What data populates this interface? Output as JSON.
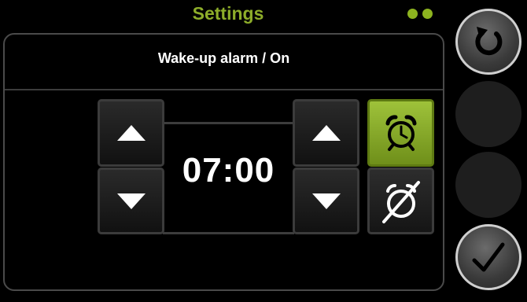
{
  "header": {
    "title": "Settings",
    "page_indicator_count": 2,
    "accent_color": "#8db31f"
  },
  "alarm": {
    "subtitle": "Wake-up alarm / On",
    "time": "07:00",
    "state": "on"
  },
  "icons": {
    "hour_up": "up-arrow-icon",
    "hour_down": "down-arrow-icon",
    "minute_up": "up-arrow-icon",
    "minute_down": "down-arrow-icon",
    "alarm_on": "alarm-clock-icon",
    "alarm_off": "alarm-off-icon",
    "back": "back-icon",
    "confirm": "checkmark-icon"
  }
}
